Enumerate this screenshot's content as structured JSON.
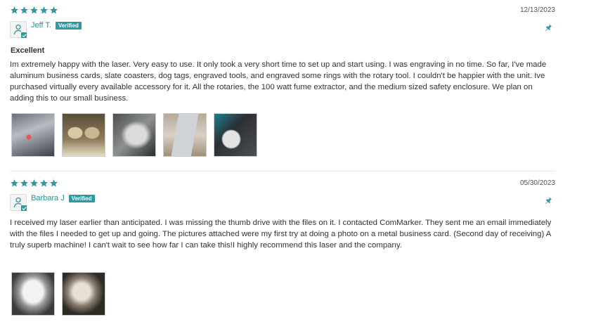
{
  "colors": {
    "accent": "#2e9aa0",
    "star": "#2e9aa0",
    "text": "#333333",
    "date": "#555555"
  },
  "reviews": [
    {
      "rating": 5,
      "date": "12/13/2023",
      "author": "Jeff T.",
      "badge": "Verified",
      "title": "Excellent",
      "body": "Im extremely happy with the laser. Very easy to use. It only took a very short time to set up and start using. I was engraving in no time. So far, I've made aluminum business cards, slate coasters, dog tags, engraved tools, and engraved some rings with the rotary tool. I couldn't be happier with the unit. Ive purchased virtually every available accessory for it. All the rotaries, the 100 watt fume extractor, and the medium sized safety enclosure. We plan on adding this to our small business.",
      "photo_count": 5
    },
    {
      "rating": 5,
      "date": "05/30/2023",
      "author": "Barbara J",
      "badge": "Verified",
      "title": "",
      "body": " I received my laser earlier than anticipated. I was missing the thumb drive with the files on it. I contacted ComMarker. They sent me an email immediately with the files I needed to get up and going. The pictures attached were my first try at doing a photo on a metal business card. (Second day of receiving) A truly superb machine! I can't wait to see how far I can take this!I highly recommend this laser and the company.",
      "photo_count": 2
    }
  ]
}
